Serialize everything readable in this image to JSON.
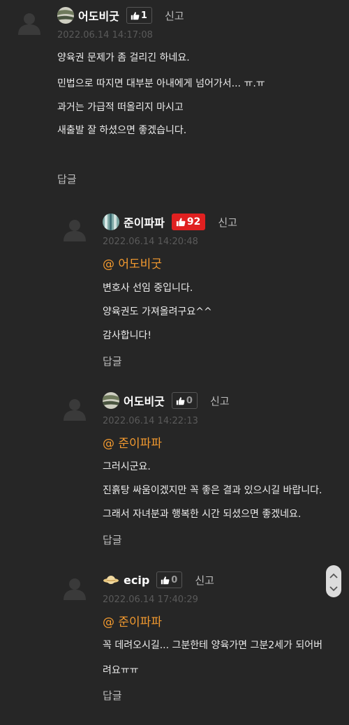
{
  "comments": [
    {
      "nick": "어도비굿",
      "likes": "1",
      "report": "신고",
      "date": "2022.06.14 14:17:08",
      "mention": "",
      "lines": [
        "양육권 문제가 좀 걸리긴 하네요.",
        "민법으로 따지면 대부분 아내에게 넘어가서... ㅠ.ㅠ",
        "과거는 가급적 떠올리지 마시고",
        "새출발 잘 하셨으면 좋겠습니다."
      ],
      "reply": "답글"
    },
    {
      "nick": "준이파파",
      "likes": "92",
      "report": "신고",
      "date": "2022.06.14 14:20:48",
      "mention": "@ 어도비굿",
      "lines": [
        "변호사 선임 중입니다.",
        "양육권도 가져올려구요^^",
        "감사합니다!"
      ],
      "reply": "답글"
    },
    {
      "nick": "어도비굿",
      "likes": "0",
      "report": "신고",
      "date": "2022.06.14 14:22:13",
      "mention": "@ 준이파파",
      "lines": [
        "그러시군요.",
        "진흙탕 싸움이겠지만 꼭 좋은 결과 있으시길 바랍니다.",
        "그래서 자녀분과 행복한 시간 되셨으면 좋겠네요."
      ],
      "reply": "답글"
    },
    {
      "nick": "ecip",
      "likes": "0",
      "report": "신고",
      "date": "2022.06.14 17:40:29",
      "mention": "@ 준이파파",
      "lines": [
        "꼭 데려오시길... 그분한테 양육가면 그분2세가 되어버",
        "려요ㅠㅠ"
      ],
      "reply": "답글"
    }
  ],
  "icons": {
    "default_avatar": "person-silhouette-icon",
    "like": "thumbs-up-icon",
    "scroll": "scroll-up-down-icon"
  },
  "colors": {
    "background": "#262626",
    "mention": "#f39a2f",
    "hot_like": "#e02020",
    "date": "#5a5a5a"
  }
}
